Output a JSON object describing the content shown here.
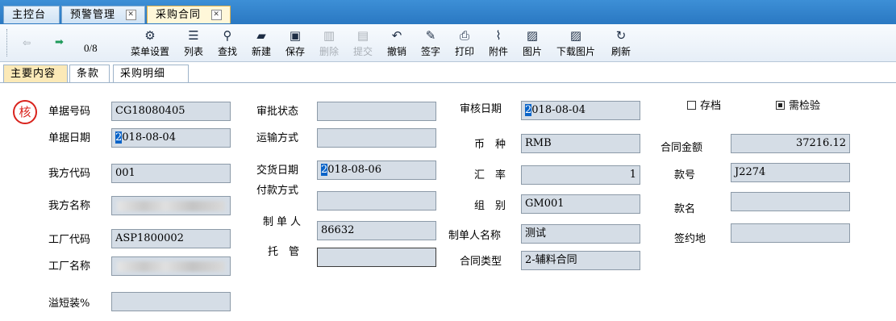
{
  "window_tabs": [
    {
      "label": "主控台",
      "closable": false,
      "active": false
    },
    {
      "label": "预警管理",
      "closable": true,
      "active": false
    },
    {
      "label": "采购合同",
      "closable": true,
      "active": true
    }
  ],
  "toolbar": {
    "nav": {
      "page": "0/8",
      "prev_icon": "arrow-left-icon",
      "next_icon": "arrow-right-icon"
    },
    "buttons": [
      {
        "label": "菜单设置",
        "icon": "gear-icon",
        "enabled": true
      },
      {
        "label": "列表",
        "icon": "list-icon",
        "enabled": true
      },
      {
        "label": "查找",
        "icon": "search-icon",
        "enabled": true
      },
      {
        "label": "新建",
        "icon": "new-folder-icon",
        "enabled": true
      },
      {
        "label": "保存",
        "icon": "save-icon",
        "enabled": true
      },
      {
        "label": "删除",
        "icon": "trash-icon",
        "enabled": false
      },
      {
        "label": "提交",
        "icon": "clipboard-icon",
        "enabled": false
      },
      {
        "label": "撤销",
        "icon": "undo-icon",
        "enabled": true
      },
      {
        "label": "签字",
        "icon": "pen-icon",
        "enabled": true
      },
      {
        "label": "打印",
        "icon": "printer-icon",
        "enabled": true
      },
      {
        "label": "附件",
        "icon": "paperclip-icon",
        "enabled": true
      },
      {
        "label": "图片",
        "icon": "image-icon",
        "enabled": true
      },
      {
        "label": "下载图片",
        "icon": "download-image-icon",
        "enabled": true
      },
      {
        "label": "刷新",
        "icon": "refresh-icon",
        "enabled": true
      }
    ]
  },
  "inner_tabs": [
    {
      "label": "主要内容",
      "active": true
    },
    {
      "label": "条款",
      "active": false
    },
    {
      "label": "采购明细",
      "active": false
    }
  ],
  "seal": {
    "text": "核",
    "color": "#d9231d"
  },
  "form": {
    "doc_no": {
      "label": "单据号码",
      "value": "CG18080405"
    },
    "doc_date": {
      "label": "单据日期",
      "value": "2018-08-04"
    },
    "our_code": {
      "label": "我方代码",
      "value": "001"
    },
    "our_name": {
      "label": "我方名称",
      "value": ""
    },
    "factory_code": {
      "label": "工厂代码",
      "value": "ASP1800002"
    },
    "factory_name": {
      "label": "工厂名称",
      "value": ""
    },
    "overflow": {
      "label": "溢短装%",
      "value": ""
    },
    "approval_status": {
      "label": "审批状态",
      "value": ""
    },
    "transport": {
      "label": "运输方式",
      "value": ""
    },
    "delivery_date": {
      "label": "交货日期",
      "value": "2018-08-06"
    },
    "payment": {
      "label": "付款方式",
      "value": ""
    },
    "maker": {
      "label": "制单人",
      "value": "86632"
    },
    "custody": {
      "label": "托　管",
      "value": ""
    },
    "audit_date": {
      "label": "审核日期",
      "value": "2018-08-04"
    },
    "currency": {
      "label": "币　种",
      "value": "RMB"
    },
    "exchange_rate": {
      "label": "汇　率",
      "value": "1"
    },
    "group": {
      "label": "组　别",
      "value": "GM001"
    },
    "maker_name": {
      "label": "制单人名称",
      "value": "测试"
    },
    "contract_type": {
      "label": "合同类型",
      "value": "2-辅料合同"
    },
    "contract_amount": {
      "label": "合同金额",
      "value": "37216.12"
    },
    "style_no": {
      "label": "款号",
      "value": "J2274"
    },
    "style_name": {
      "label": "款名",
      "value": ""
    },
    "sign_place": {
      "label": "签约地",
      "value": ""
    },
    "archived": {
      "label": "存档",
      "checked": false
    },
    "need_inspection": {
      "label": "需检验",
      "checked": true
    }
  },
  "colors": {
    "tabbar": "#2a78c2",
    "field_bg": "#d5dde6",
    "active_inner_tab": "#fbe9b7",
    "seal": "#d9231d"
  }
}
